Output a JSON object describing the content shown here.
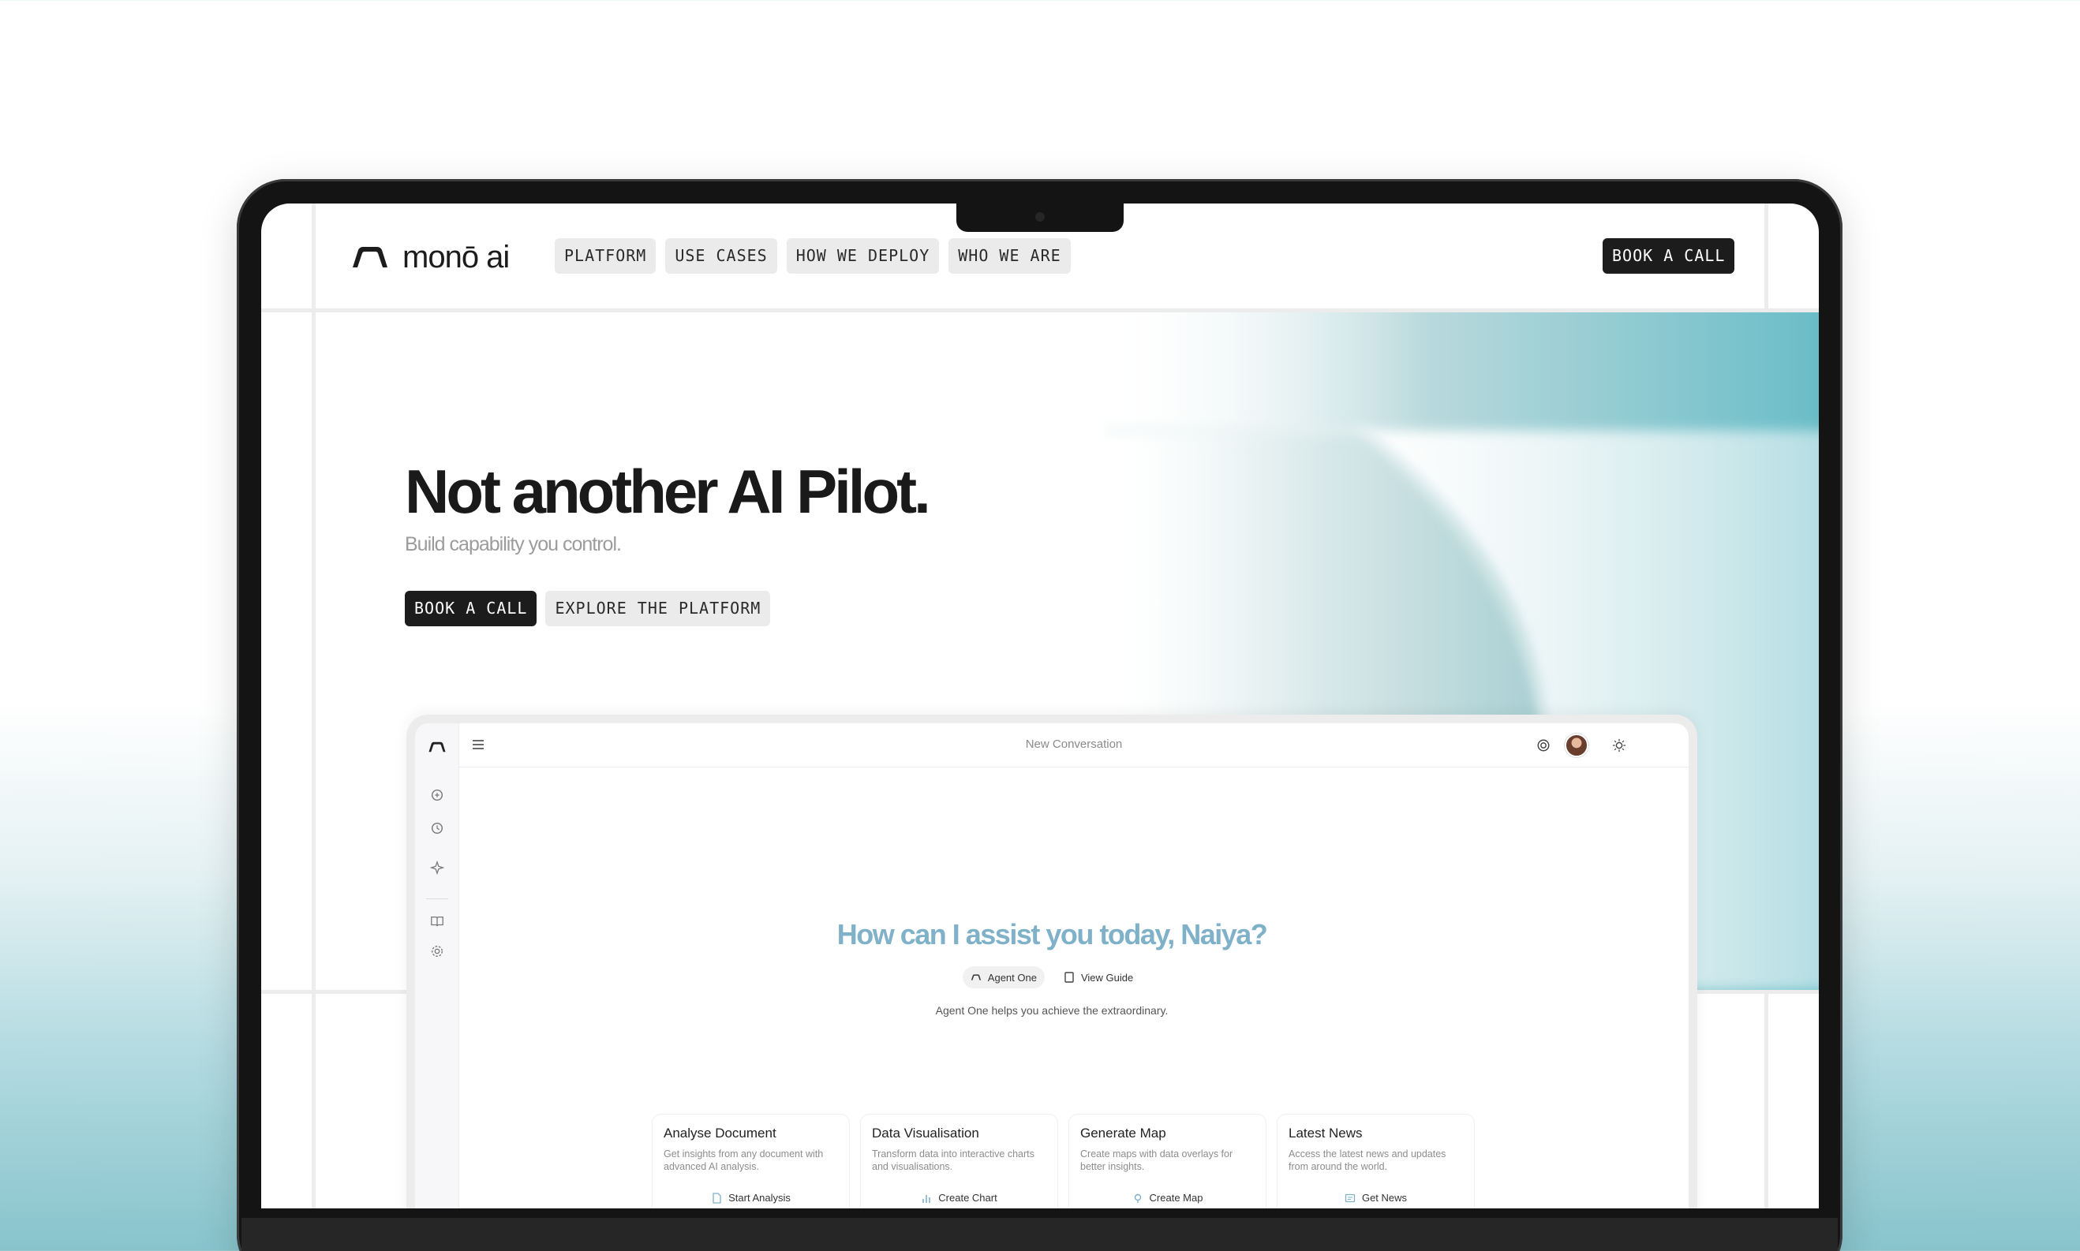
{
  "brand": {
    "name": "monō ai"
  },
  "nav": {
    "items": [
      {
        "label": "PLATFORM"
      },
      {
        "label": "USE CASES"
      },
      {
        "label": "HOW WE DEPLOY"
      },
      {
        "label": "WHO WE ARE"
      }
    ],
    "cta_label": "BOOK A CALL"
  },
  "hero": {
    "title": "Not another AI Pilot.",
    "subtitle": "Build capability you control.",
    "primary_button": "BOOK A CALL",
    "secondary_button": "EXPLORE THE PLATFORM"
  },
  "app": {
    "conversation_title": "New Conversation",
    "sidebar_icons": [
      "logo-icon",
      "chat-icon",
      "chat-history-icon",
      "sparkle-icon",
      "book-icon",
      "settings-icon"
    ],
    "topbar_icons": [
      "menu-icon",
      "openai-icon",
      "avatar",
      "sun-icon"
    ],
    "greeting": "How can I assist you today, Naiya?",
    "pills": [
      {
        "label": "Agent One",
        "icon": "logo-icon"
      },
      {
        "label": "View Guide",
        "icon": "book-icon"
      }
    ],
    "description": "Agent One helps you achieve the extraordinary.",
    "cards": [
      {
        "title": "Analyse Document",
        "description": "Get insights from any document with advanced AI analysis.",
        "action": "Start Analysis",
        "icon": "document-icon"
      },
      {
        "title": "Data Visualisation",
        "description": "Transform data into interactive charts and visualisations.",
        "action": "Create Chart",
        "icon": "chart-icon"
      },
      {
        "title": "Generate Map",
        "description": "Create maps with data overlays for better insights.",
        "action": "Create Map",
        "icon": "map-pin-icon"
      },
      {
        "title": "Latest News",
        "description": "Access the latest news and updates from around the world.",
        "action": "Get News",
        "icon": "news-icon"
      }
    ]
  },
  "colors": {
    "accent_teal": "#2fa3b6",
    "greeting_blue": "#7fb1c9",
    "dark_button": "#1c1c1c",
    "light_button": "#ebebeb"
  }
}
